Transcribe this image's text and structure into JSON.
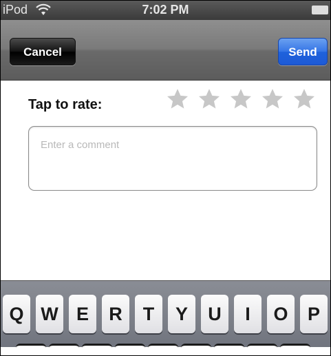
{
  "status_bar": {
    "carrier": "iPod",
    "time": "7:02 PM",
    "wifi_icon": "wifi-icon",
    "battery_icon": "battery-icon"
  },
  "nav_bar": {
    "cancel_label": "Cancel",
    "send_label": "Send"
  },
  "rating": {
    "label": "Tap to rate:",
    "max_stars": 5,
    "selected_stars": 0,
    "star_color": "#c7c7c7"
  },
  "comment": {
    "placeholder": "Enter a comment",
    "value": ""
  },
  "keyboard": {
    "row1": [
      "Q",
      "W",
      "E",
      "R",
      "T",
      "Y",
      "U",
      "I",
      "O",
      "P"
    ]
  },
  "colors": {
    "send_blue": "#2a6ee6",
    "nav_gray": "#7a7a7a",
    "keyboard_gray": "#7b7f89"
  }
}
